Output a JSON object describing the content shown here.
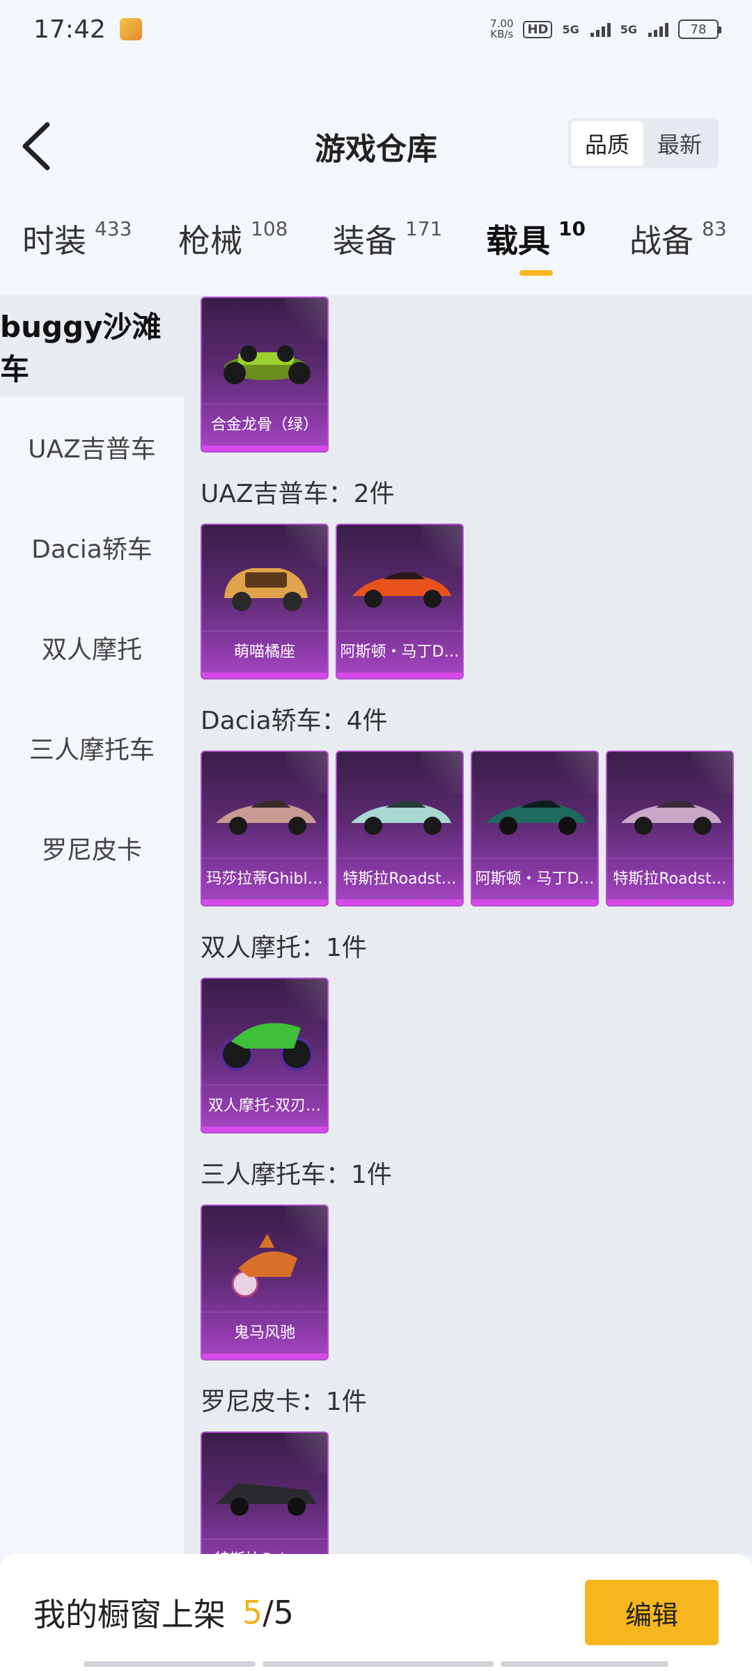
{
  "status_bar": {
    "time": "17:42",
    "net_speed_value": "7.00",
    "net_speed_unit": "KB/s",
    "hd_label": "HD",
    "sim1_label": "5G",
    "sim2_label": "5G",
    "battery": "78"
  },
  "header": {
    "title": "游戏仓库",
    "sort_options": [
      "品质",
      "最新"
    ]
  },
  "tabs": [
    {
      "label": "时装",
      "count": "433"
    },
    {
      "label": "枪械",
      "count": "108"
    },
    {
      "label": "装备",
      "count": "171"
    },
    {
      "label": "载具",
      "count": "10"
    },
    {
      "label": "战备",
      "count": "83"
    }
  ],
  "sidebar": {
    "items": [
      "buggy沙滩车",
      "UAZ吉普车",
      "Dacia轿车",
      "双人摩托",
      "三人摩托车",
      "罗尼皮卡"
    ]
  },
  "sections": [
    {
      "title": "",
      "items": [
        "合金龙骨（绿）"
      ]
    },
    {
      "title": "UAZ吉普车：2件",
      "items": [
        "萌喵橘座",
        "阿斯顿・马丁D…"
      ]
    },
    {
      "title": "Dacia轿车：4件",
      "items": [
        "玛莎拉蒂Ghibl…",
        "特斯拉Roadst…",
        "阿斯顿・马丁D…",
        "特斯拉Roadst…"
      ]
    },
    {
      "title": "双人摩托：1件",
      "items": [
        "双人摩托-双刃…"
      ]
    },
    {
      "title": "三人摩托车：1件",
      "items": [
        "鬼马风驰"
      ]
    },
    {
      "title": "罗尼皮卡：1件",
      "items": [
        "特斯拉Cybe…"
      ]
    }
  ],
  "bottom_bar": {
    "label": "我的橱窗上架",
    "current": "5",
    "total": "/5",
    "edit_label": "编辑"
  },
  "colors": {
    "accent": "#f6b61d",
    "card_purple": "#8a3aa6",
    "background": "#f3f6fb",
    "content_bg": "#e8ecf1"
  }
}
